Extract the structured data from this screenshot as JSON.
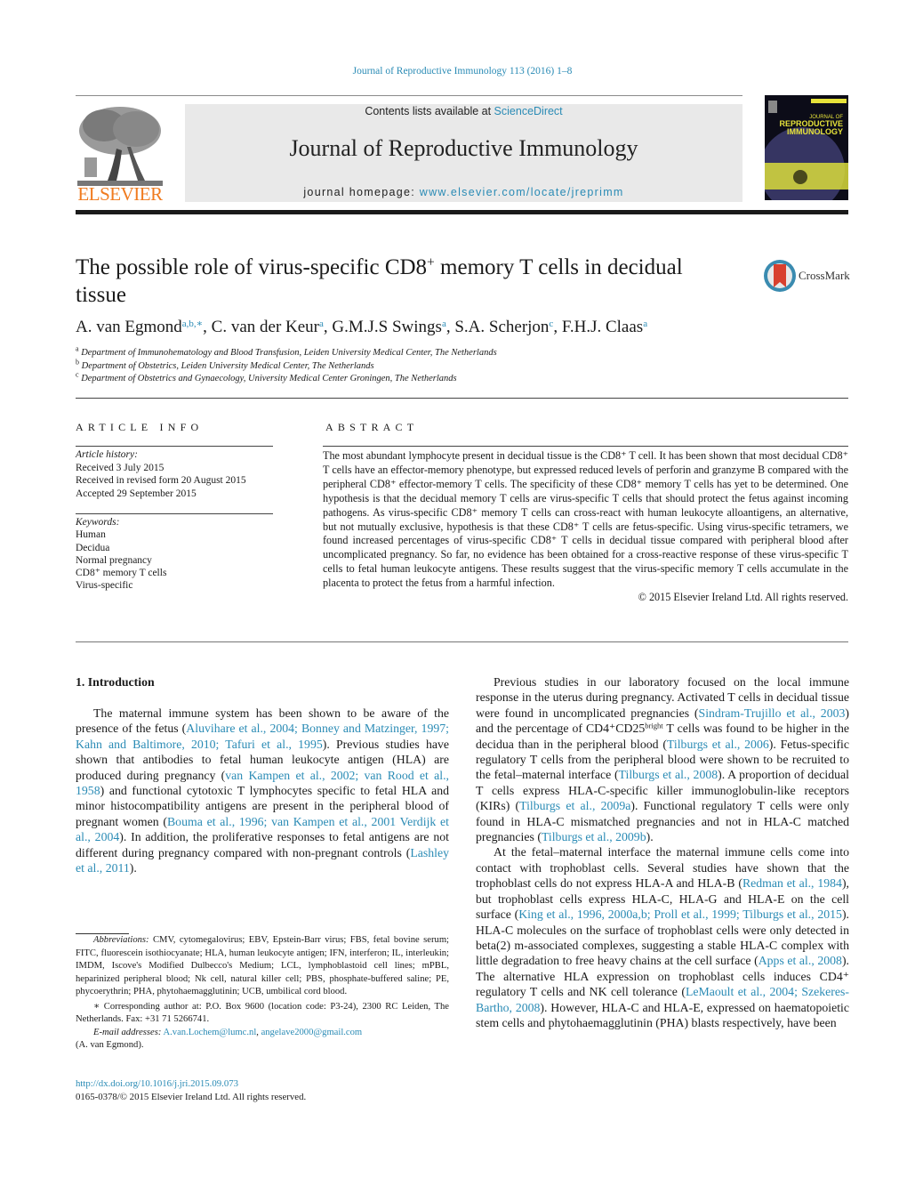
{
  "header": {
    "citation": "Journal of Reproductive Immunology 113 (2016) 1–8",
    "contents_prefix": "Contents lists available at ",
    "contents_link": "ScienceDirect",
    "journal_title": "Journal of Reproductive Immunology",
    "homepage_prefix": "journal homepage: ",
    "homepage_link": "www.elsevier.com/locate/jreprimm",
    "publisher_logo": "ELSEVIER",
    "cover_title_line1": "JOURNAL OF",
    "cover_title_line2": "REPRODUCTIVE",
    "cover_title_line3": "IMMUNOLOGY"
  },
  "article": {
    "title_part1": "The possible role of virus-specific CD8",
    "title_sup": "+",
    "title_part2": " memory T cells in decidual tissue",
    "crossmark_label": "CrossMark",
    "authors": [
      {
        "name": "A. van Egmond",
        "sup": "a,b,∗"
      },
      {
        "name": "C. van der Keur",
        "sup": "a"
      },
      {
        "name": "G.M.J.S Swings",
        "sup": "a"
      },
      {
        "name": "S.A. Scherjon",
        "sup": "c"
      },
      {
        "name": "F.H.J. Claas",
        "sup": "a"
      }
    ],
    "affiliations": [
      {
        "key": "a",
        "text": "Department of Immunohematology and Blood Transfusion, Leiden University Medical Center, The Netherlands"
      },
      {
        "key": "b",
        "text": "Department of Obstetrics, Leiden University Medical Center, The Netherlands"
      },
      {
        "key": "c",
        "text": "Department of Obstetrics and Gynaecology, University Medical Center Groningen, The Netherlands"
      }
    ]
  },
  "article_info": {
    "heading": "ARTICLE INFO",
    "history_label": "Article history:",
    "history": [
      "Received 3 July 2015",
      "Received in revised form 20 August 2015",
      "Accepted 29 September 2015"
    ],
    "keywords_label": "Keywords:",
    "keywords": [
      "Human",
      "Decidua",
      "Normal pregnancy",
      "CD8⁺ memory T cells",
      "Virus-specific"
    ]
  },
  "abstract": {
    "heading": "ABSTRACT",
    "text": "The most abundant lymphocyte present in decidual tissue is the CD8⁺ T cell. It has been shown that most decidual CD8⁺ T cells have an effector-memory phenotype, but expressed reduced levels of perforin and granzyme B compared with the peripheral CD8⁺ effector-memory T cells. The specificity of these CD8⁺ memory T cells has yet to be determined. One hypothesis is that the decidual memory T cells are virus-specific T cells that should protect the fetus against incoming pathogens. As virus-specific CD8⁺ memory T cells can cross-react with human leukocyte alloantigens, an alternative, but not mutually exclusive, hypothesis is that these CD8⁺ T cells are fetus-specific. Using virus-specific tetramers, we found increased percentages of virus-specific CD8⁺ T cells in decidual tissue compared with peripheral blood after uncomplicated pregnancy. So far, no evidence has been obtained for a cross-reactive response of these virus-specific T cells to fetal human leukocyte antigens. These results suggest that the virus-specific memory T cells accumulate in the placenta to protect the fetus from a harmful infection.",
    "copyright": "© 2015 Elsevier Ireland Ltd. All rights reserved."
  },
  "body": {
    "section_heading": "1.  Introduction",
    "left_para": [
      {
        "t": "The maternal immune system has been shown to be aware of the presence of the fetus ("
      },
      {
        "l": "Aluvihare et al., 2004; Bonney and Matzinger, 1997; Kahn and Baltimore, 2010; Tafuri et al., 1995"
      },
      {
        "t": "). Previous studies have shown that antibodies to fetal human leukocyte antigen (HLA) are produced during pregnancy ("
      },
      {
        "l": "van Kampen et al., 2002; van Rood et al., 1958"
      },
      {
        "t": ") and functional cytotoxic T lymphocytes specific to fetal HLA and minor histocompatibility antigens are present in the peripheral blood of pregnant women ("
      },
      {
        "l": "Bouma et al., 1996; van Kampen et al., 2001 Verdijk et al., 2004"
      },
      {
        "t": "). In addition, the proliferative responses to fetal antigens are not different during pregnancy compared with non-pregnant controls ("
      },
      {
        "l": "Lashley et al., 2011"
      },
      {
        "t": ")."
      }
    ],
    "right_para1": [
      {
        "t": "Previous studies in our laboratory focused on the local immune response in the uterus during pregnancy. Activated T cells in decidual tissue were found in uncomplicated pregnancies ("
      },
      {
        "l": "Sindram-Trujillo et al., 2003"
      },
      {
        "t": ") and the percentage of CD4⁺CD25"
      },
      {
        "s": "bright"
      },
      {
        "t": " T cells was found to be higher in the decidua than in the peripheral blood ("
      },
      {
        "l": "Tilburgs et al., 2006"
      },
      {
        "t": "). Fetus-specific regulatory T cells from the peripheral blood were shown to be recruited to the fetal–maternal interface ("
      },
      {
        "l": "Tilburgs et al., 2008"
      },
      {
        "t": "). A proportion of decidual T cells express HLA-C-specific killer immunoglobulin-like receptors (KIRs) ("
      },
      {
        "l": "Tilburgs et al., 2009a"
      },
      {
        "t": "). Functional regulatory T cells were only found in HLA-C mismatched pregnancies and not in HLA-C matched pregnancies ("
      },
      {
        "l": "Tilburgs et al., 2009b"
      },
      {
        "t": ")."
      }
    ],
    "right_para2": [
      {
        "t": "At the fetal–maternal interface the maternal immune cells come into contact with trophoblast cells. Several studies have shown that the trophoblast cells do not express HLA-A and HLA-B ("
      },
      {
        "l": "Redman et al., 1984"
      },
      {
        "t": "), but trophoblast cells express HLA-C, HLA-G and HLA-E on the cell surface ("
      },
      {
        "l": "King et al., 1996, 2000a,b; Proll et al., 1999; Tilburgs et al., 2015"
      },
      {
        "t": "). HLA-C molecules on the surface of trophoblast cells were only detected in beta(2) m-associated complexes, suggesting a stable HLA-C complex with little degradation to free heavy chains at the cell surface ("
      },
      {
        "l": "Apps et al., 2008"
      },
      {
        "t": "). The alternative HLA expression on trophoblast cells induces CD4⁺ regulatory T cells and NK cell tolerance ("
      },
      {
        "l": "LeMaoult et al., 2004; Szekeres-Bartho, 2008"
      },
      {
        "t": "). However, HLA-C and HLA-E, expressed on haematopoietic stem cells and phytohaemagglutinin (PHA) blasts respectively, have been"
      }
    ]
  },
  "footnotes": {
    "abbrev_label": "Abbreviations:",
    "abbrev_text": " CMV, cytomegalovirus; EBV, Epstein-Barr virus; FBS, fetal bovine serum; FITC, fluorescein isothiocyanate; HLA, human leukocyte antigen; IFN, interferon; IL, interleukin; IMDM, Iscove's Modified Dulbecco's Medium; LCL, lymphoblastoid cell lines; mPBL, heparinized peripheral blood; Nk cell, natural killer cell; PBS, phosphate-buffered saline; PE, phycoerythrin; PHA, phytohaemagglutinin; UCB, umbilical cord blood.",
    "corresponding": "∗  Corresponding author at: P.O. Box 9600 (location code: P3-24), 2300 RC Leiden, The Netherlands. Fax: +31 71 5266741.",
    "email_label": "E-mail addresses:",
    "email1": "A.van.Lochem@lumc.nl",
    "email_sep": ", ",
    "email2": "angelave2000@gmail.com",
    "email_owner": "(A. van Egmond).",
    "doi": "http://dx.doi.org/10.1016/j.jri.2015.09.073",
    "issn": "0165-0378/© 2015 Elsevier Ireland Ltd. All rights reserved."
  }
}
